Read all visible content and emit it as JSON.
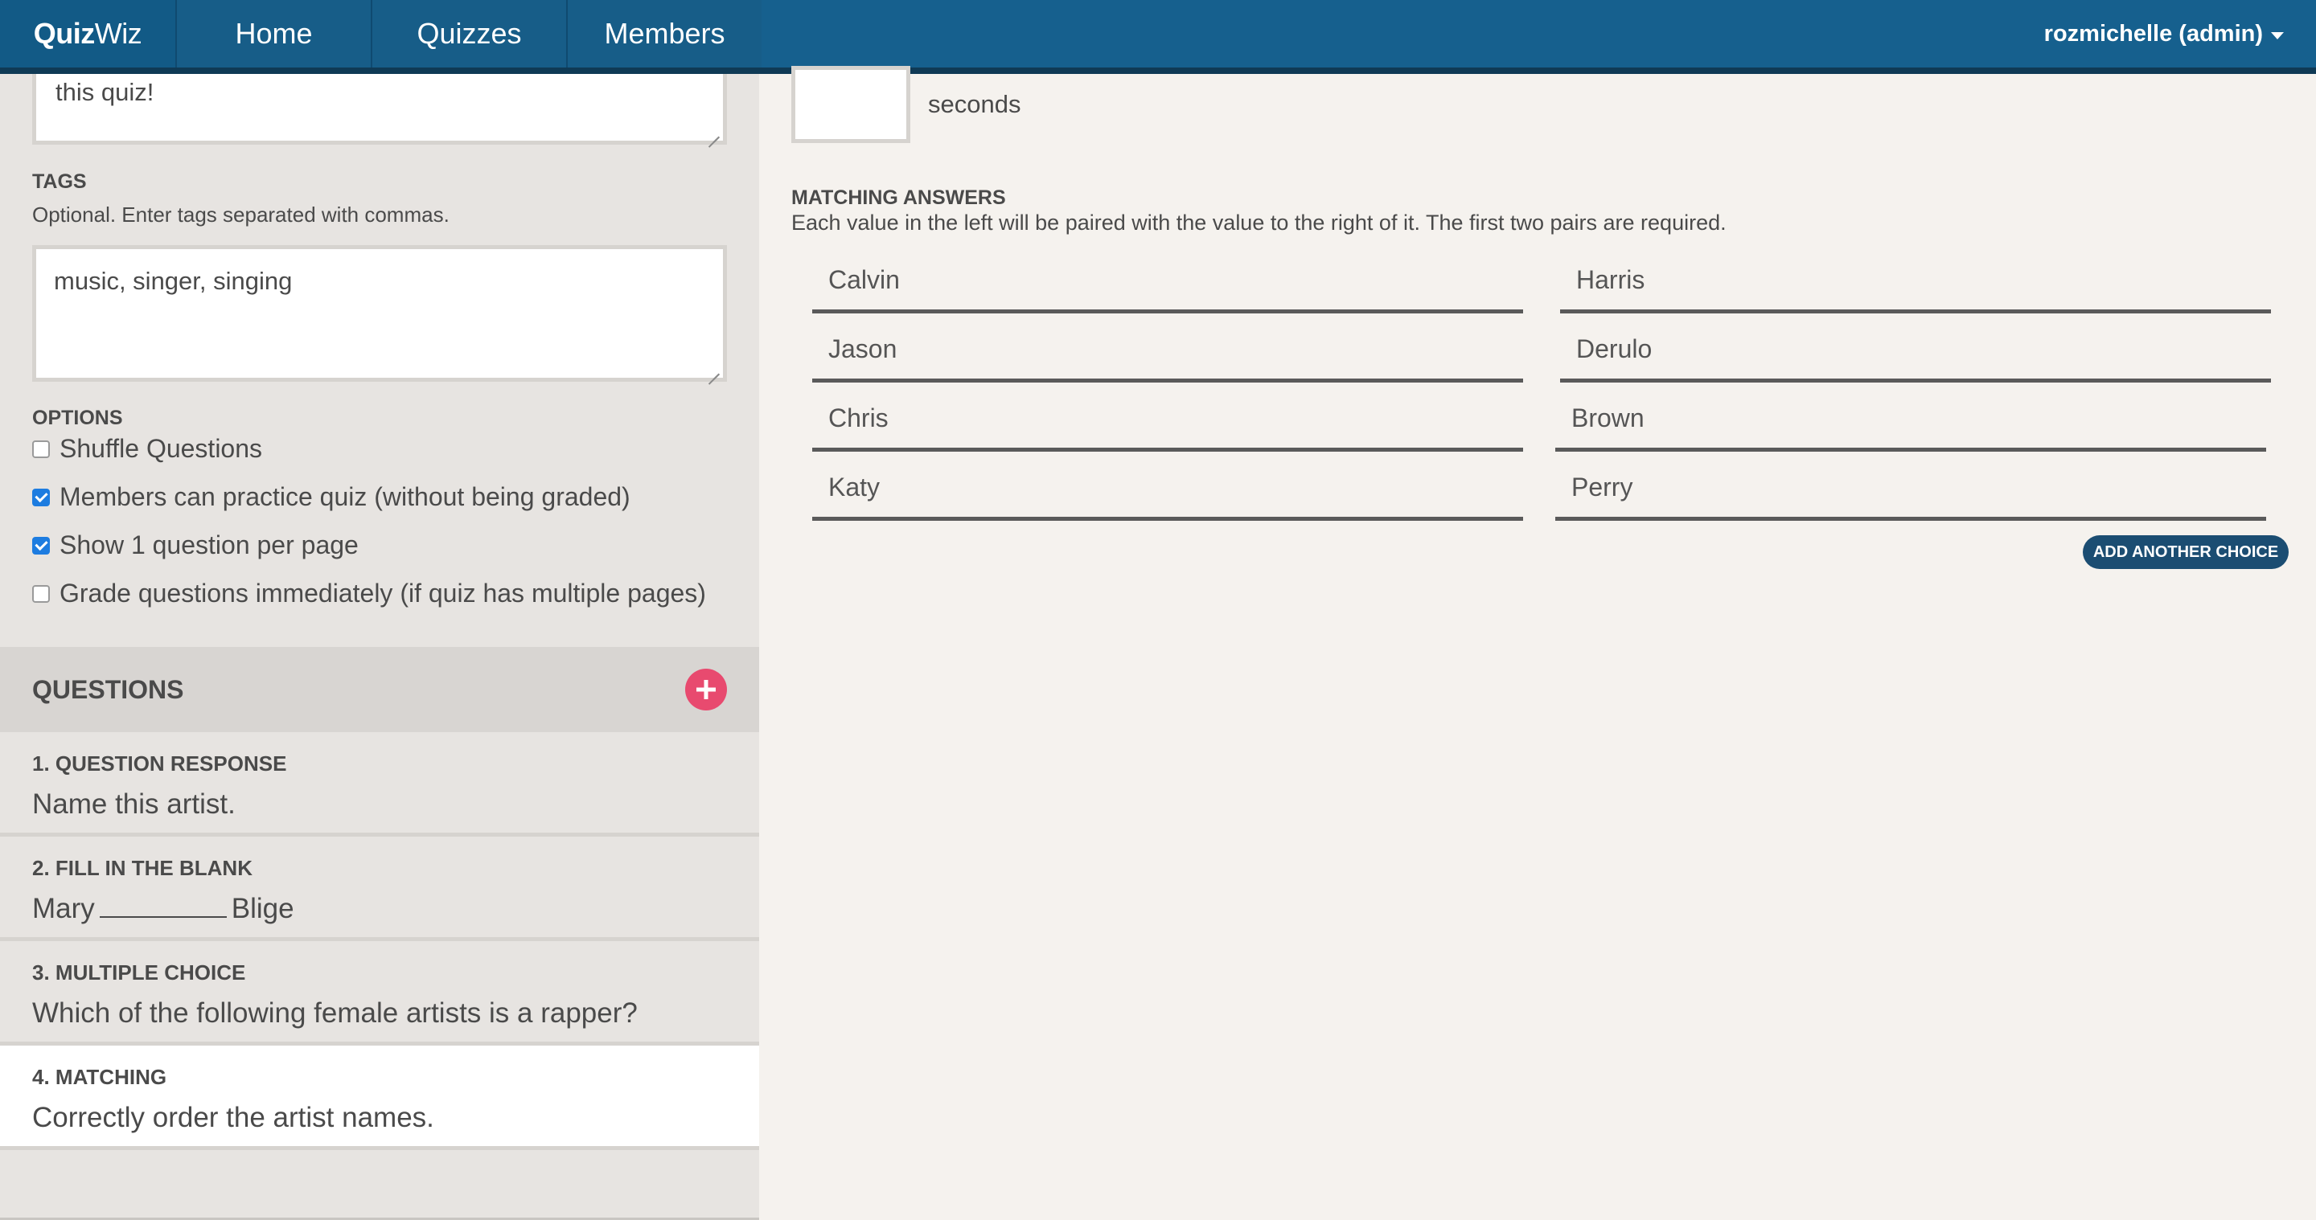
{
  "app": {
    "brand_bold": "Quiz",
    "brand_light": "Wiz"
  },
  "nav": {
    "items": [
      {
        "label": "Home"
      },
      {
        "label": "Quizzes"
      },
      {
        "label": "Members"
      }
    ],
    "user_label": "rozmichelle (admin)"
  },
  "sidebar": {
    "description_value": "this quiz!",
    "tags": {
      "label": "TAGS",
      "help": "Optional. Enter tags separated with commas.",
      "value": "music, singer, singing"
    },
    "options": {
      "label": "OPTIONS",
      "items": [
        {
          "label": "Shuffle Questions",
          "checked": false
        },
        {
          "label": "Members can practice quiz (without being graded)",
          "checked": true
        },
        {
          "label": "Show 1 question per page",
          "checked": true
        },
        {
          "label": "Grade questions immediately (if quiz has multiple pages)",
          "checked": false
        }
      ]
    },
    "questions": {
      "title": "QUESTIONS",
      "add_icon": "plus-circle-icon",
      "add_color": "#e84a6f",
      "items": [
        {
          "type": "1. QUESTION RESPONSE",
          "text": "Name this artist."
        },
        {
          "type": "2. FILL IN THE BLANK",
          "text_before": "Mary",
          "text_after": "Blige"
        },
        {
          "type": "3. MULTIPLE CHOICE",
          "text": "Which of the following female artists is a rapper?"
        },
        {
          "type": "4. MATCHING",
          "text": "Correctly order the artist names.",
          "active": true
        }
      ]
    }
  },
  "main": {
    "seconds_label": "seconds",
    "matching": {
      "title": "MATCHING ANSWERS",
      "help": "Each value in the left will be paired with the value to the right of it. The first two pairs are required.",
      "pairs": [
        {
          "left": "Calvin",
          "right": "Harris"
        },
        {
          "left": "Jason",
          "right": "Derulo"
        },
        {
          "left": "Chris",
          "right": "Brown"
        },
        {
          "left": "Katy",
          "right": "Perry"
        }
      ],
      "add_button": "ADD ANOTHER CHOICE"
    }
  },
  "colors": {
    "navbar": "#16608e",
    "accent_button": "#1b4d72",
    "checkbox_checked": "#1d7ce0"
  }
}
